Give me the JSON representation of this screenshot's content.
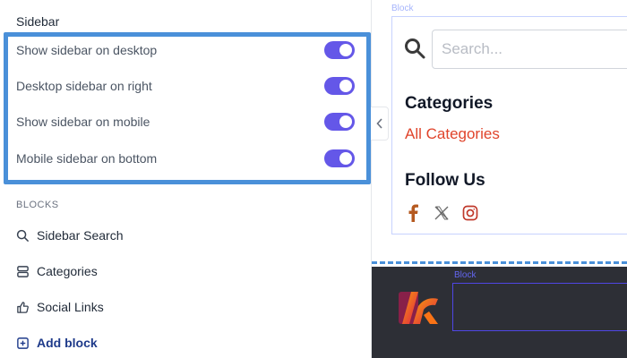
{
  "sidebar_settings": {
    "title": "Sidebar",
    "toggles": [
      {
        "label": "Show sidebar on desktop",
        "on": true
      },
      {
        "label": "Desktop sidebar on right",
        "on": true
      },
      {
        "label": "Show sidebar on mobile",
        "on": true
      },
      {
        "label": "Mobile sidebar on bottom",
        "on": true
      }
    ],
    "toggle_color": "#6457e8",
    "highlight_color": "#4a90d9"
  },
  "blocks": {
    "heading": "BLOCKS",
    "items": [
      {
        "label": "Sidebar Search",
        "icon": "search-icon"
      },
      {
        "label": "Categories",
        "icon": "stack-icon"
      },
      {
        "label": "Social Links",
        "icon": "thumbs-up-icon"
      }
    ],
    "add_label": "Add block"
  },
  "preview": {
    "block_tag": "Block",
    "search_placeholder": "Search...",
    "categories_heading": "Categories",
    "categories_link": "All Categories",
    "follow_heading": "Follow Us",
    "social_icons": [
      "facebook-icon",
      "x-icon",
      "instagram-icon"
    ],
    "footer_block_tag": "Block"
  }
}
